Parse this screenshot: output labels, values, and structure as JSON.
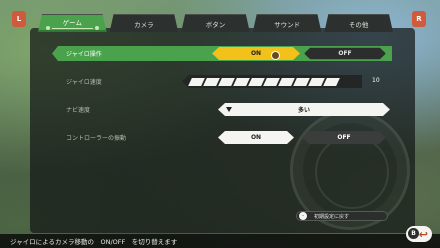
{
  "tabs": [
    {
      "label": "ゲーム",
      "active": true
    },
    {
      "label": "カメラ",
      "active": false
    },
    {
      "label": "ボタン",
      "active": false
    },
    {
      "label": "サウンド",
      "active": false
    },
    {
      "label": "その他",
      "active": false
    }
  ],
  "shoulder_left": "L",
  "shoulder_right": "R",
  "settings": {
    "gyro": {
      "label": "ジャイロ操作",
      "on": "ON",
      "off": "OFF"
    },
    "gyro_speed": {
      "label": "ジャイロ速度",
      "value": "10",
      "level": 10
    },
    "navi_speed": {
      "label": "ナビ速度",
      "value": "多い"
    },
    "rumble": {
      "label": "コントローラーの振動",
      "on": "ON",
      "off": "OFF"
    }
  },
  "reset": {
    "label": "初期設定に戻す",
    "button": "-"
  },
  "footer": {
    "hint": "ジャイロによるカメラ移動の　ON/OFF　を切り替えます"
  },
  "back": {
    "button": "B",
    "glyph": "↩"
  },
  "colors": {
    "accent": "#4aa34c",
    "selected": "#f2c21b",
    "shoulder": "#cf5a3c"
  }
}
